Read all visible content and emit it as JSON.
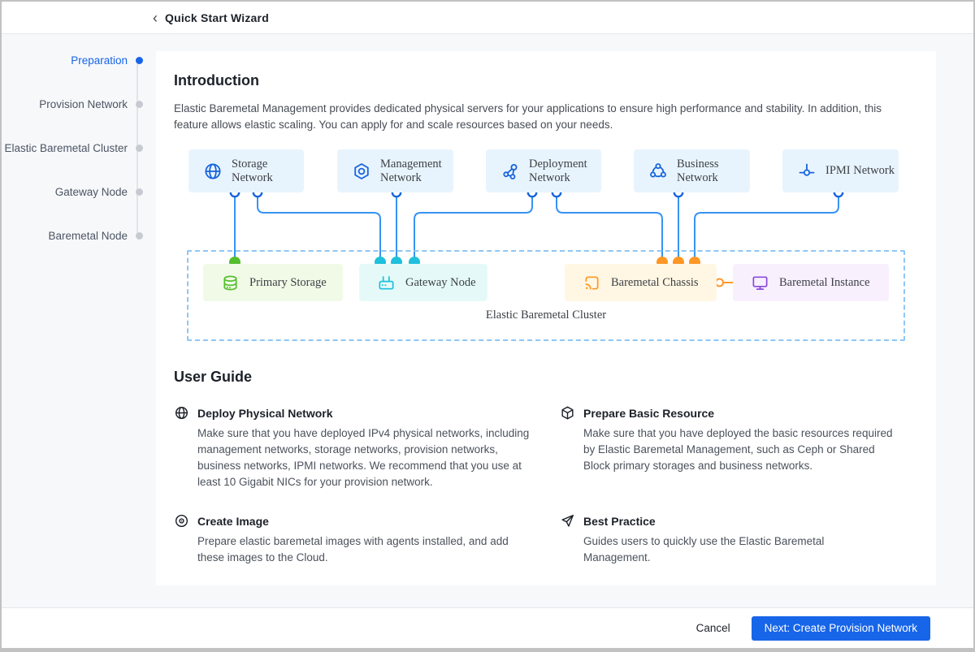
{
  "header": {
    "back": "‹",
    "title": "Quick Start Wizard"
  },
  "sidebar": {
    "steps": [
      {
        "label": "Preparation",
        "active": true
      },
      {
        "label": "Provision Network",
        "active": false
      },
      {
        "label": "Elastic Baremetal Cluster",
        "active": false
      },
      {
        "label": "Gateway Node",
        "active": false
      },
      {
        "label": "Baremetal Node",
        "active": false
      }
    ]
  },
  "intro": {
    "heading": "Introduction",
    "body": "Elastic Baremetal Management provides dedicated physical servers for your applications to ensure high performance and stability. In addition, this feature allows elastic scaling. You can apply for and scale resources based on your needs."
  },
  "diagram": {
    "networks": [
      {
        "label": "Storage Network",
        "icon": "globe-icon"
      },
      {
        "label": "Management Network",
        "icon": "hexagon-nut-icon"
      },
      {
        "label": "Deployment Network",
        "icon": "share-nodes-icon"
      },
      {
        "label": "Business Network",
        "icon": "cluster-icon"
      },
      {
        "label": "IPMI Network",
        "icon": "commit-link-icon"
      }
    ],
    "nodes": [
      {
        "label": "Primary Storage",
        "icon": "database-icon",
        "accent": "#54BE2E"
      },
      {
        "label": "Gateway Node",
        "icon": "router-icon",
        "accent": "#1FC0DB"
      },
      {
        "label": "Baremetal Chassis",
        "icon": "chassis-cast-icon",
        "accent": "#FF9726"
      },
      {
        "label": "Baremetal Instance",
        "icon": "monitor-icon",
        "accent": "#8A4BDB"
      }
    ],
    "cluster_label": "Elastic Baremetal Cluster"
  },
  "user_guide": {
    "heading": "User Guide",
    "items": [
      {
        "icon": "globe-icon",
        "heading": "Deploy Physical Network",
        "body": "Make sure that you have deployed IPv4 physical networks, including management networks, storage networks, provision networks, business networks, IPMI networks. We recommend that you use at least 10 Gigabit NICs for your provision network."
      },
      {
        "icon": "cube-icon",
        "heading": "Prepare Basic Resource",
        "body": "Make sure that you have deployed the basic resources required by Elastic Baremetal Management, such as Ceph or Shared Block primary storages and business networks."
      },
      {
        "icon": "target-icon",
        "heading": "Create Image",
        "body": "Prepare elastic baremetal images with agents installed, and add these images to the Cloud."
      },
      {
        "icon": "send-icon",
        "heading": "Best Practice",
        "body": "Guides users to quickly use the Elastic Baremetal Management."
      }
    ]
  },
  "footer": {
    "cancel": "Cancel",
    "next": "Next: Create Provision Network"
  },
  "colors": {
    "accent_blue": "#1765E8",
    "wire_blue": "#3693F4",
    "network_box_bg": "#E8F4FD",
    "storage_green": "#54BE2E",
    "gateway_cyan": "#1FC0DB",
    "chassis_orange": "#FF9726",
    "instance_purple": "#8A4BDB",
    "primary_button_bg": "#1765E8"
  }
}
